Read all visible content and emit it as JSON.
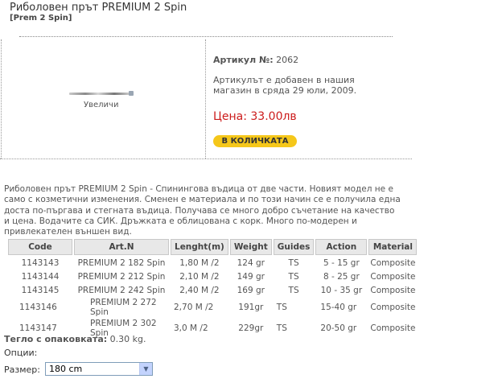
{
  "product": {
    "title": "Риболовен прът PREMIUM 2 Spin",
    "subtitle": "[Prem 2 Spin]",
    "zoom_label": "Увеличи",
    "article_label": "Артикул №:",
    "article_number": "2062",
    "added_text": "Артикулът е добавен в нашия магазин в сряда 29 юли, 2009.",
    "price_label": "Цена:",
    "price": "33.00лв",
    "buy_button": "В КОЛИЧКАТА"
  },
  "description": "Риболовен прът PREMIUM  2 Spin - Спинингова въдица от две части. Новият модел не е само с козметични изменения. Сменен е материала и по този начин се е получила една доста по-пъргава и стегната въдица. Получава се много добро съчетание на качество и цена. Водачите са СИК. Дръжката е облицована с корк. Много по-модерен и привлекателен външен вид.",
  "specs": {
    "headers": [
      "Code",
      "Art.N",
      "Lenght(m)",
      "Weight",
      "Guides",
      "Action",
      "Material"
    ],
    "rows": [
      [
        "1143143",
        "PREMIUM 2 182 Spin",
        "1,80 M /2",
        "124 gr",
        "TS",
        "5 - 15 gr",
        "Composite"
      ],
      [
        "1143144",
        "PREMIUM 2 212 Spin",
        "2,10 M /2",
        "149 gr",
        "TS",
        "8 - 25 gr",
        "Composite"
      ],
      [
        "1143145",
        "PREMIUM 2 242 Spin",
        "2,40 M /2",
        "169 gr",
        "TS",
        "10 - 35 gr",
        "Composite"
      ],
      [
        "1143146",
        "PREMIUM 2 272 Spin",
        "2,70 M /2",
        "191gr",
        "TS",
        "15-40 gr",
        "Composite"
      ],
      [
        "1143147",
        "PREMIUM 2 302 Spin",
        "3,0 M /2",
        "229gr",
        "TS",
        "20-50 gr",
        "Composite"
      ]
    ]
  },
  "package": {
    "label": "Тегло с опаковката:",
    "value": "0.30 kg."
  },
  "options": {
    "label": "Опции:",
    "size_label": "Размер:",
    "size_selected": "180 cm"
  },
  "colors": {
    "price": "#cc1b1b",
    "button": "#f5c71a"
  },
  "icons": {
    "select_arrow": "chevron-down-icon"
  }
}
